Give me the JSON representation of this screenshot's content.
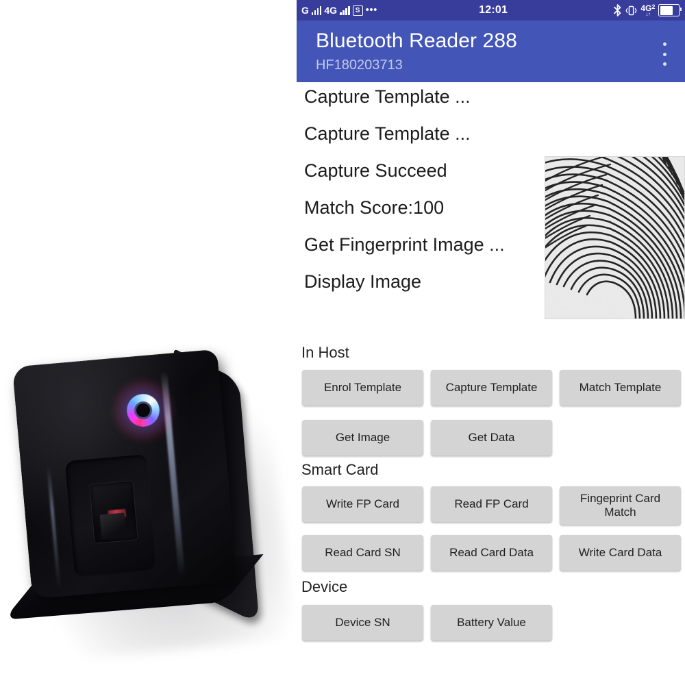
{
  "device_photo": {
    "alt": "Black bluetooth fingerprint reader with RGB LED ring and optical sensor window"
  },
  "phone": {
    "status_bar": {
      "carrier_g_label": "G",
      "network_label": "4G",
      "sim_badge": "S",
      "more_dots": "•••",
      "time": "12:01",
      "bluetooth_icon": "bluetooth-icon",
      "vibrate_icon": "vibrate-icon",
      "data_network_label": "4G",
      "data_network_sub": "2",
      "data_arrows": "↓↑",
      "battery_icon": "battery-icon"
    },
    "app_bar": {
      "title": "Bluetooth Reader 288",
      "subtitle": "HF180203713",
      "overflow_icon": "overflow-menu-icon"
    },
    "log": [
      "Capture Template ...",
      "Capture Template ...",
      "Capture Succeed",
      "Match Score:100",
      "Get Fingerprint Image ...",
      "Display Image"
    ],
    "fingerprint_preview": {
      "label": "fingerprint-image"
    },
    "sections": [
      {
        "label": "In Host",
        "buttons": [
          "Enrol Template",
          "Capture Template",
          "Match Template",
          "Get Image",
          "Get Data"
        ]
      },
      {
        "label": "Smart Card",
        "buttons": [
          "Write FP Card",
          "Read FP Card",
          "Fingeprint Card Match",
          "Read Card SN",
          "Read Card Data",
          "Write Card Data"
        ]
      },
      {
        "label": "Device",
        "buttons": [
          "Device SN",
          "Battery Value"
        ]
      }
    ]
  },
  "colors": {
    "status_bar_bg": "#383d9c",
    "app_bar_bg": "#4356b7",
    "subtitle_text": "#c3cbe8",
    "button_bg": "#d4d4d4",
    "page_bg": "#ffffff",
    "log_text": "#1c1c1c"
  }
}
